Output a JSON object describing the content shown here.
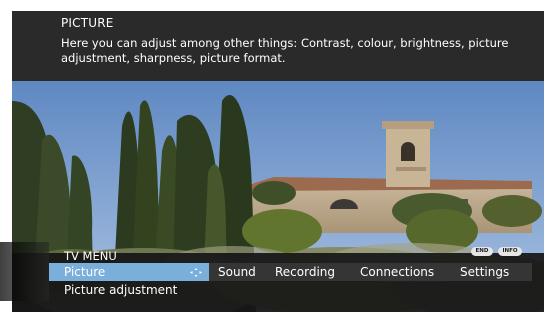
{
  "info": {
    "title": "PICTURE",
    "text": "Here you can adjust among other things: Contrast, colour, brightness, picture adjustment, sharpness, picture format."
  },
  "menu": {
    "title": "TV MENU",
    "buttons": {
      "end": "END",
      "info": "INFO"
    },
    "tabs": [
      {
        "label": "Picture",
        "selected": true
      },
      {
        "label": "Sound",
        "selected": false
      },
      {
        "label": "Recording",
        "selected": false
      },
      {
        "label": "Connections",
        "selected": false
      },
      {
        "label": "Settings",
        "selected": false
      }
    ],
    "sub_items": [
      {
        "label": "Picture adjustment"
      }
    ],
    "nav_icon": "four-way-arrows-icon"
  },
  "colors": {
    "selected_tab": "#7aaedb",
    "panel": "#2a2a2a",
    "sky": "#6f95c9"
  }
}
